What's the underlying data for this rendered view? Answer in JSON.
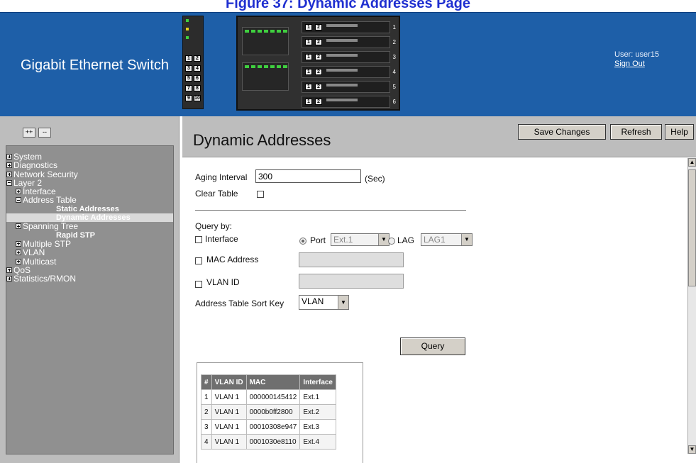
{
  "figure_caption": "Figure 37: Dynamic Addresses Page",
  "header": {
    "app_title": "Gigabit Ethernet Switch",
    "user_label": "User: user15",
    "sign_out": "Sign Out",
    "small_chassis_buttons": [
      "1",
      "2",
      "3",
      "4",
      "5",
      "6",
      "7",
      "8",
      "9",
      "10"
    ],
    "blade_numbers": [
      "1",
      "2",
      "3",
      "4",
      "5",
      "6"
    ]
  },
  "sidebar": {
    "expand_all": "++",
    "collapse_all": "--",
    "tree": [
      {
        "label": "System",
        "level": 0,
        "icon": "plus"
      },
      {
        "label": "Diagnostics",
        "level": 0,
        "icon": "plus"
      },
      {
        "label": "Network Security",
        "level": 0,
        "icon": "plus"
      },
      {
        "label": "Layer 2",
        "level": 0,
        "icon": "minus"
      },
      {
        "label": "Interface",
        "level": 1,
        "icon": "plus"
      },
      {
        "label": "Address Table",
        "level": 1,
        "icon": "minus"
      },
      {
        "label": "Static Addresses",
        "level": 2,
        "icon": "none"
      },
      {
        "label": "Dynamic Addresses",
        "level": 2,
        "icon": "none",
        "selected": true
      },
      {
        "label": "Spanning Tree",
        "level": 1,
        "icon": "plus"
      },
      {
        "label": "Rapid STP",
        "level": 2,
        "icon": "none"
      },
      {
        "label": "Multiple STP",
        "level": 1,
        "icon": "plus"
      },
      {
        "label": "VLAN",
        "level": 1,
        "icon": "plus"
      },
      {
        "label": "Multicast",
        "level": 1,
        "icon": "plus"
      },
      {
        "label": "QoS",
        "level": 0,
        "icon": "plus"
      },
      {
        "label": "Statistics/RMON",
        "level": 0,
        "icon": "plus"
      }
    ]
  },
  "main": {
    "title": "Dynamic Addresses",
    "buttons": {
      "save": "Save Changes",
      "refresh": "Refresh",
      "help": "Help"
    },
    "aging_label": "Aging Interval",
    "aging_value": "300",
    "aging_unit": "(Sec)",
    "clear_table_label": "Clear Table",
    "query_by_label": "Query by:",
    "interface_label": "Interface",
    "port_label": "Port",
    "port_value": "Ext.1",
    "lag_label": "LAG",
    "lag_value": "LAG1",
    "mac_label": "MAC Address",
    "mac_value": "",
    "vlan_label": "VLAN ID",
    "vlan_value": "",
    "sort_key_label": "Address Table Sort Key",
    "sort_key_value": "VLAN",
    "query_button": "Query",
    "table": {
      "headers": [
        "#",
        "VLAN ID",
        "MAC",
        "Interface"
      ],
      "rows": [
        [
          "1",
          "VLAN 1",
          "000000145412",
          "Ext.1"
        ],
        [
          "2",
          "VLAN 1",
          "0000b0ff2800",
          "Ext.2"
        ],
        [
          "3",
          "VLAN 1",
          "00010308e947",
          "Ext.3"
        ],
        [
          "4",
          "VLAN 1",
          "0001030e8110",
          "Ext.4"
        ]
      ]
    }
  }
}
